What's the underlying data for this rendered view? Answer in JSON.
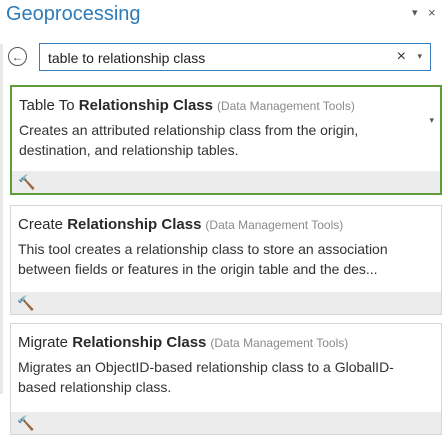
{
  "header": {
    "title": "Geoprocessing",
    "pin_icon": "▾",
    "close_icon": "×"
  },
  "search": {
    "value": "table to relationship class",
    "clear_icon": "×",
    "dropdown_icon": "▾",
    "back_icon": "←"
  },
  "results": [
    {
      "pre": "Table To ",
      "bold": "Relationship Class",
      "category": "(Data Management Tools)",
      "description": "Creates an attributed relationship class from the origin, destination, and relationship tables.",
      "selected": true
    },
    {
      "pre": "Create ",
      "bold": "Relationship Class",
      "category": "(Data Management Tools)",
      "description": "This tool creates a relationship class to store an association between fields or features in the origin table and the des...",
      "selected": false
    },
    {
      "pre": "Migrate ",
      "bold": "Relationship Class",
      "category": "(Data Management Tools)",
      "description": "Migrates an ObjectID-based relationship class to a GlobalID-based relationship class.",
      "selected": false
    }
  ],
  "colors": {
    "accent": "#2e7bb8",
    "selected_border": "#5e9c3a"
  },
  "icons": {
    "tool": "hammer-icon",
    "expand": "chevron-down-icon"
  }
}
